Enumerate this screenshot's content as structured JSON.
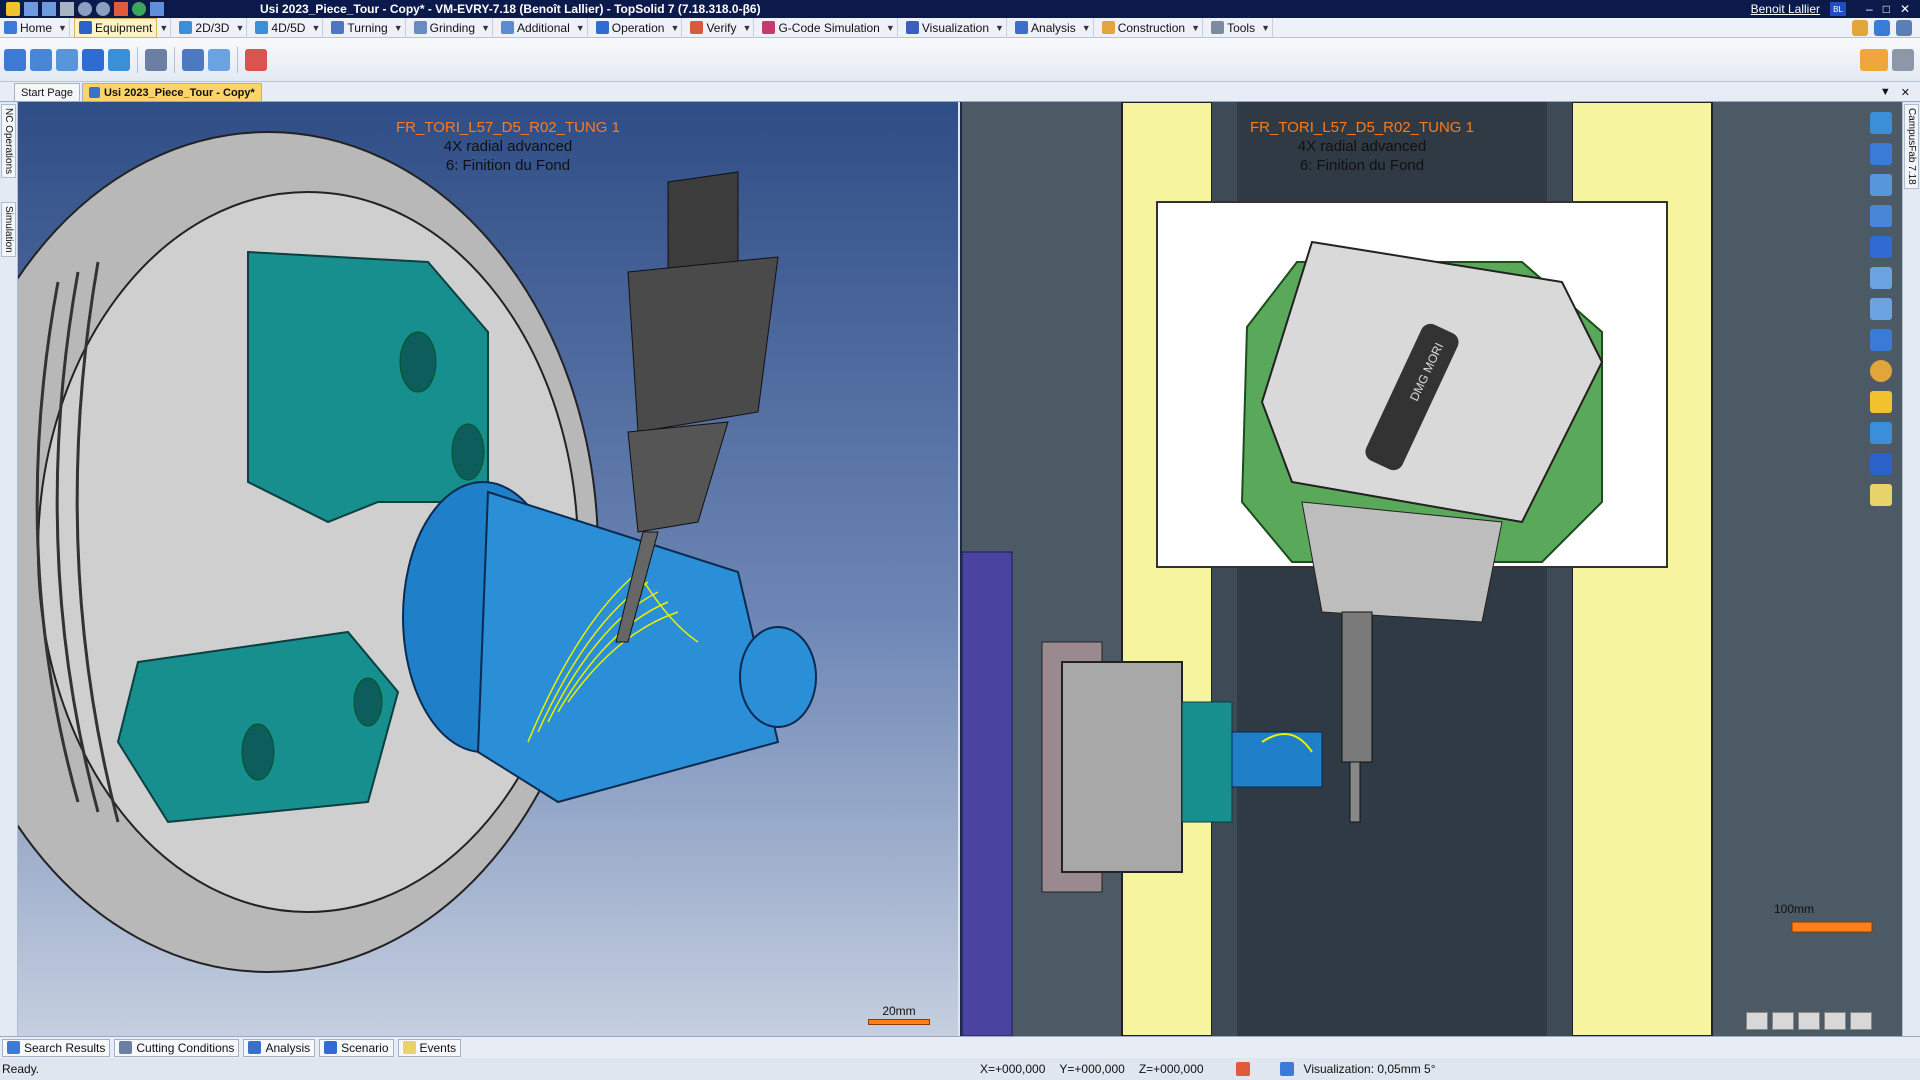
{
  "window": {
    "title": "Usi 2023_Piece_Tour - Copy* - VM-EVRY-7.18 (Benoît Lallier) - TopSolid 7 (7.18.318.0-β6)",
    "user_name": "Benoit Lallier",
    "user_initials": "BL",
    "controls": [
      "?",
      "–",
      "□",
      "✕"
    ]
  },
  "menu": {
    "items": [
      {
        "label": "Home",
        "icon": "home-icon",
        "color": "#3b7bd8"
      },
      {
        "label": "Equipment",
        "icon": "equipment-icon",
        "color": "#2a62c9",
        "active": true
      },
      {
        "label": "2D/3D",
        "icon": "2d3d-icon",
        "color": "#3b8fd8"
      },
      {
        "label": "4D/5D",
        "icon": "4d5d-icon",
        "color": "#3b8fd8"
      },
      {
        "label": "Turning",
        "icon": "turning-icon",
        "color": "#4a76c4"
      },
      {
        "label": "Grinding",
        "icon": "grinding-icon",
        "color": "#6a8bbf"
      },
      {
        "label": "Additional",
        "icon": "additional-icon",
        "color": "#5b8ad6"
      },
      {
        "label": "Operation",
        "icon": "operation-icon",
        "color": "#2f6bd0"
      },
      {
        "label": "Verify",
        "icon": "verify-icon",
        "color": "#d65a3b"
      },
      {
        "label": "G-Code Simulation",
        "icon": "gcode-icon",
        "color": "#c23b6b"
      },
      {
        "label": "Visualization",
        "icon": "visualization-icon",
        "color": "#3a5fbf"
      },
      {
        "label": "Analysis",
        "icon": "analysis-icon",
        "color": "#3b6fc9"
      },
      {
        "label": "Construction",
        "icon": "construction-icon",
        "color": "#e2a53a"
      },
      {
        "label": "Tools",
        "icon": "tools-icon",
        "color": "#7d8b9e"
      }
    ]
  },
  "tabs": {
    "start": "Start Page",
    "document": "Usi 2023_Piece_Tour - Copy*"
  },
  "side_tabs": {
    "nc_operations": "NC Operations",
    "simulation": "Simulation",
    "campusfab": "CampusFab 7.18"
  },
  "viewport_left": {
    "tool": "FR_TORI_L57_D5_R02_TUNG 1",
    "strategy": "4X radial advanced",
    "step": "6: Finition du Fond",
    "scale": "20mm"
  },
  "viewport_right": {
    "tool": "FR_TORI_L57_D5_R02_TUNG 1",
    "strategy": "4X radial advanced",
    "step": "6: Finition du Fond",
    "scale": "100mm",
    "spindle_brand": "DMG MORI"
  },
  "bottom_tabs": [
    "Search Results",
    "Cutting Conditions",
    "Analysis",
    "Scenario",
    "Events"
  ],
  "status": {
    "text": "Ready.",
    "x": "X=+000,000",
    "y": "Y=+000,000",
    "z": "Z=+000,000",
    "visualization": "Visualization: 0,05mm 5°"
  },
  "colors": {
    "titlebar": "#0b1a4a",
    "accent_tab": "#fbd56a",
    "part_blue": "#1f7fc8",
    "chuck_teal": "#17898a",
    "toolpath_yellow": "#e8f000",
    "tool_label_orange": "#ff7a1a",
    "machine_yellow": "#f7f4a0"
  }
}
